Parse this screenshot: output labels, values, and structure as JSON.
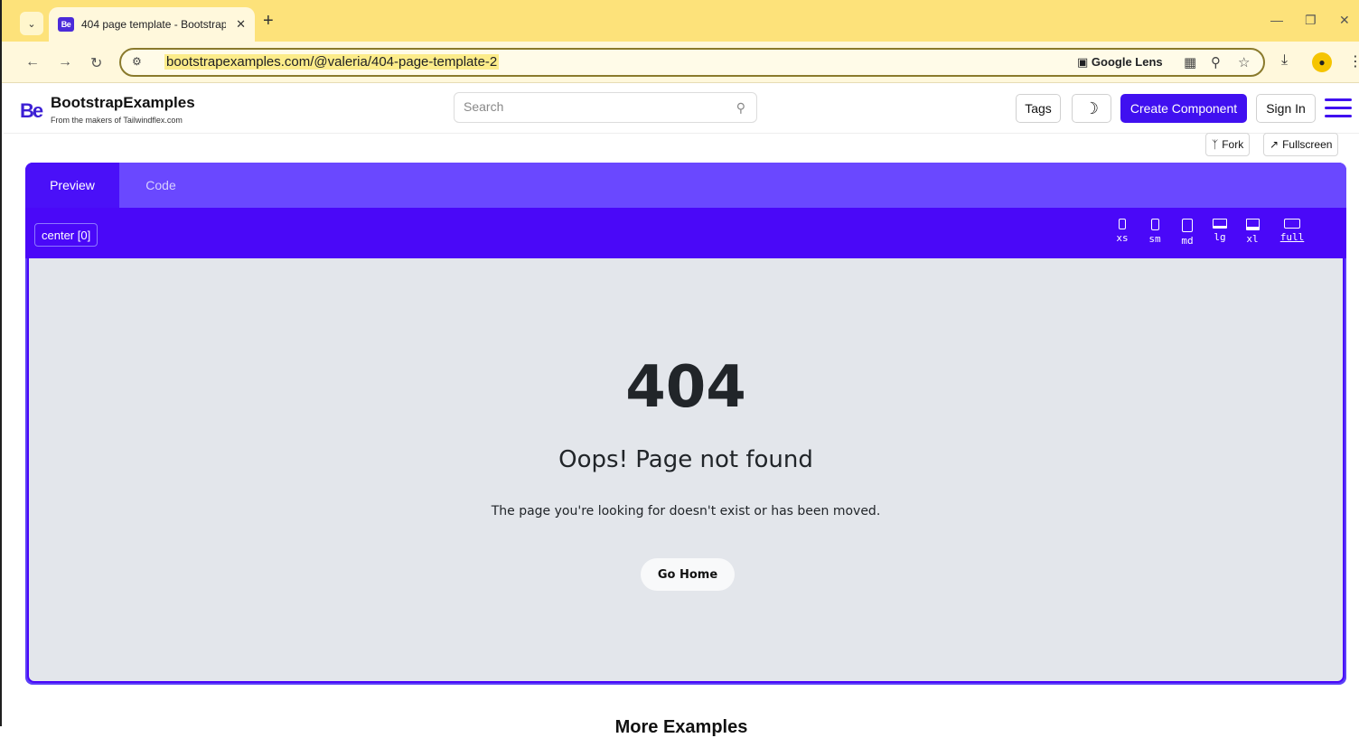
{
  "browser": {
    "tab_title": "404 page template - Bootstrap",
    "tab_favicon": "Be",
    "new_tab": "+",
    "url": "bootstrapexamples.com/@valeria/404-page-template-2",
    "google_lens": "Google Lens"
  },
  "header": {
    "logo_mark": "Be",
    "title": "BootstrapExamples",
    "subtitle": "From the makers of Tailwindflex.com",
    "search_placeholder": "Search",
    "tags_label": "Tags",
    "create_label": "Create Component",
    "signin_label": "Sign In"
  },
  "actions": {
    "fork_label": "Fork",
    "fullscreen_label": "Fullscreen"
  },
  "preview": {
    "tabs": [
      {
        "label": "Preview",
        "active": true
      },
      {
        "label": "Code",
        "active": false
      }
    ],
    "alignment_chip": "center [0]",
    "breakpoints": [
      {
        "label": "xs",
        "icon": "phone-icon"
      },
      {
        "label": "sm",
        "icon": "phone-icon"
      },
      {
        "label": "md",
        "icon": "tablet-icon"
      },
      {
        "label": "lg",
        "icon": "laptop-icon"
      },
      {
        "label": "xl",
        "icon": "desktop-icon"
      },
      {
        "label": "full",
        "icon": "monitor-icon",
        "selected": true
      }
    ]
  },
  "content": {
    "code": "404",
    "title": "Oops! Page not found",
    "message": "The page you're looking for doesn't exist or has been moved.",
    "button": "Go Home"
  },
  "footer": {
    "more_heading": "More Examples"
  },
  "colors": {
    "accent": "#4010f0",
    "tab_strip": "#fde27a",
    "stage_bg": "#e3e6eb"
  }
}
